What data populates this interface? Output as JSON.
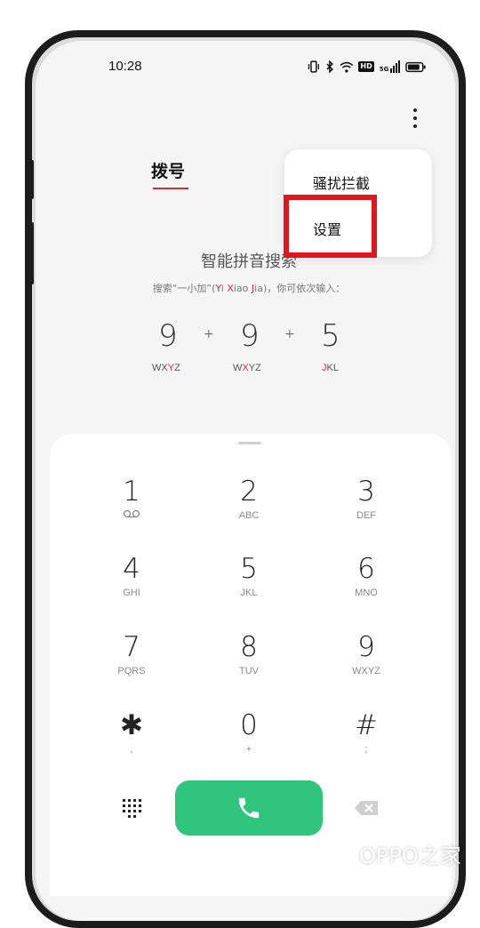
{
  "status_bar": {
    "time": "10:28",
    "icons": [
      "vibrate-icon",
      "bluetooth-icon",
      "wifi-icon",
      "hd-icon",
      "signal-5g-icon",
      "battery-icon"
    ],
    "hd_text": "HD",
    "net_text": "5G"
  },
  "header": {
    "tab_label": "拨号",
    "more_icon": "more-vertical-icon"
  },
  "menu": {
    "items": [
      "骚扰拦截",
      "设置"
    ]
  },
  "smart_search": {
    "title": "智能拼音搜索",
    "hint_prefix": "搜索“一小加”(",
    "hint_y": "Y",
    "hint_i": "i ",
    "hint_x": "X",
    "hint_iao": "iao ",
    "hint_j": "J",
    "hint_ia": "ia",
    "hint_suffix": ")，你可依次输入：",
    "digits": [
      "9",
      "9",
      "5"
    ],
    "plus": "+",
    "letters_1": {
      "a": "WX",
      "b": "Y",
      "c": "Z"
    },
    "letters_2": {
      "a": "W",
      "b": "X",
      "c": "YZ"
    },
    "letters_3": {
      "a": "J",
      "b": "KL"
    }
  },
  "keypad": {
    "keys": [
      {
        "num": "1",
        "sub": ""
      },
      {
        "num": "2",
        "sub": "ABC"
      },
      {
        "num": "3",
        "sub": "DEF"
      },
      {
        "num": "4",
        "sub": "GHI"
      },
      {
        "num": "5",
        "sub": "JKL"
      },
      {
        "num": "6",
        "sub": "MNO"
      },
      {
        "num": "7",
        "sub": "PQRS"
      },
      {
        "num": "8",
        "sub": "TUV"
      },
      {
        "num": "9",
        "sub": "WXYZ"
      },
      {
        "num": "✱",
        "sub": ","
      },
      {
        "num": "0",
        "sub": "+"
      },
      {
        "num": "#",
        "sub": ";"
      }
    ],
    "call_color": "#2fc57d"
  },
  "watermark": {
    "text": "OPPO之家"
  },
  "colors": {
    "accent_red": "#c9323c",
    "highlight_box": "#e0161f"
  }
}
